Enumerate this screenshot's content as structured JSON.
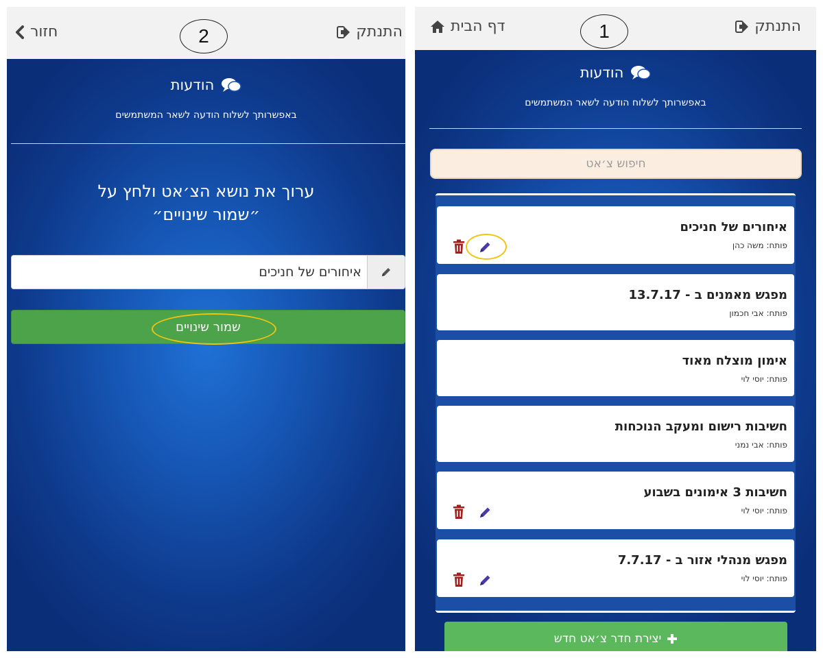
{
  "screen2": {
    "step_number": "2",
    "back_label": "חזור",
    "logout_label": "התנתק",
    "header_title": "הודעות",
    "header_subtitle": "באפשרותך לשלוח הודעה לשאר המשתמשים",
    "instruction_line1": "ערוך את נושא הצ׳אט ולחץ על",
    "instruction_line2": "״שמור שינויים״",
    "topic_value": "איחורים של חניכים",
    "save_label": "שמור שינויים"
  },
  "screen1": {
    "step_number": "1",
    "logout_label": "התנתק",
    "home_label": "דף הבית",
    "header_title": "הודעות",
    "header_subtitle": "באפשרותך לשלוח הודעה לשאר המשתמשים",
    "search_placeholder": "חיפוש צ׳אט",
    "new_chat_label": "יצירת חדר צ׳אט חדש",
    "chats": [
      {
        "title": "איחורים של חניכים",
        "opener": "פותח: משה כהן",
        "editable": true
      },
      {
        "title": "מפגש מאמנים ב - 13.7.17",
        "opener": "פותח: אבי חכמון",
        "editable": false
      },
      {
        "title": "אימון מוצלח מאוד",
        "opener": "פותח: יוסי לוי",
        "editable": false
      },
      {
        "title": "חשיבות רישום ומעקב הנוכחות",
        "opener": "פותח: אבי נמני",
        "editable": false
      },
      {
        "title": "חשיבות 3 אימונים בשבוע",
        "opener": "פותח: יוסי לוי",
        "editable": true
      },
      {
        "title": "מפגש מנהלי אזור ב - 7.7.17",
        "opener": "פותח: יוסי לוי",
        "editable": true
      }
    ]
  },
  "colors": {
    "background_blue": "#1656b4",
    "save_green": "#4ca34a",
    "highlight_yellow": "#f1c40f",
    "delete_red": "#a0201e",
    "edit_purple": "#4b3aa6"
  },
  "icons": [
    "chevron-left-icon",
    "logout-icon",
    "home-icon",
    "chat-bubbles-icon",
    "pencil-icon",
    "trash-icon",
    "plus-icon"
  ]
}
